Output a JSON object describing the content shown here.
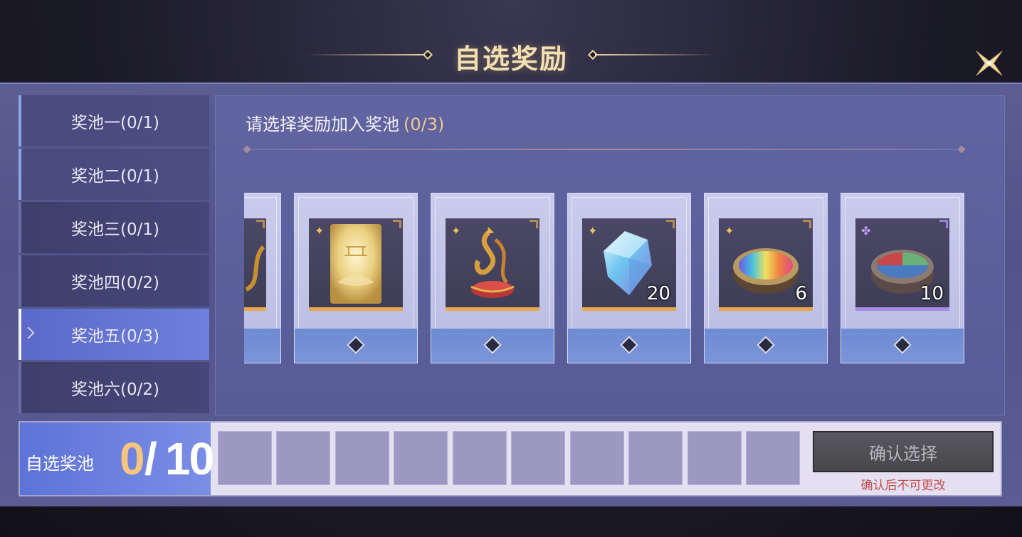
{
  "header": {
    "title": "自选奖励",
    "close_icon": "close-x-icon"
  },
  "tabs": [
    {
      "label": "奖池一(0/1)",
      "state": "done"
    },
    {
      "label": "奖池二(0/1)",
      "state": "done"
    },
    {
      "label": "奖池三(0/1)",
      "state": "normal"
    },
    {
      "label": "奖池四(0/2)",
      "state": "normal"
    },
    {
      "label": "奖池五(0/3)",
      "state": "active"
    },
    {
      "label": "奖池六(0/2)",
      "state": "normal"
    }
  ],
  "content": {
    "prompt": "请选择奖励加入奖池",
    "prompt_count": "(0/3)",
    "items": [
      {
        "name": "partial-item",
        "rarity": "gold",
        "quantity": ""
      },
      {
        "name": "golden-card-item",
        "rarity": "gold",
        "quantity": ""
      },
      {
        "name": "phoenix-ornament-item",
        "rarity": "gold",
        "quantity": ""
      },
      {
        "name": "blue-crystal-item",
        "rarity": "gold",
        "quantity": "20"
      },
      {
        "name": "rainbow-dye-bowl-item",
        "rarity": "gold",
        "quantity": "6"
      },
      {
        "name": "tri-color-dye-bowl-item",
        "rarity": "purple",
        "quantity": "10"
      }
    ]
  },
  "pool": {
    "label": "自选奖池",
    "current": "0",
    "separator": "/",
    "max": "10",
    "slot_count": 10,
    "confirm_label": "确认选择",
    "confirm_hint": "确认后不可更改"
  },
  "colors": {
    "accent_gold": "#f3c890",
    "active_tab": "#6e7fdc",
    "hint_red": "#c45050"
  }
}
